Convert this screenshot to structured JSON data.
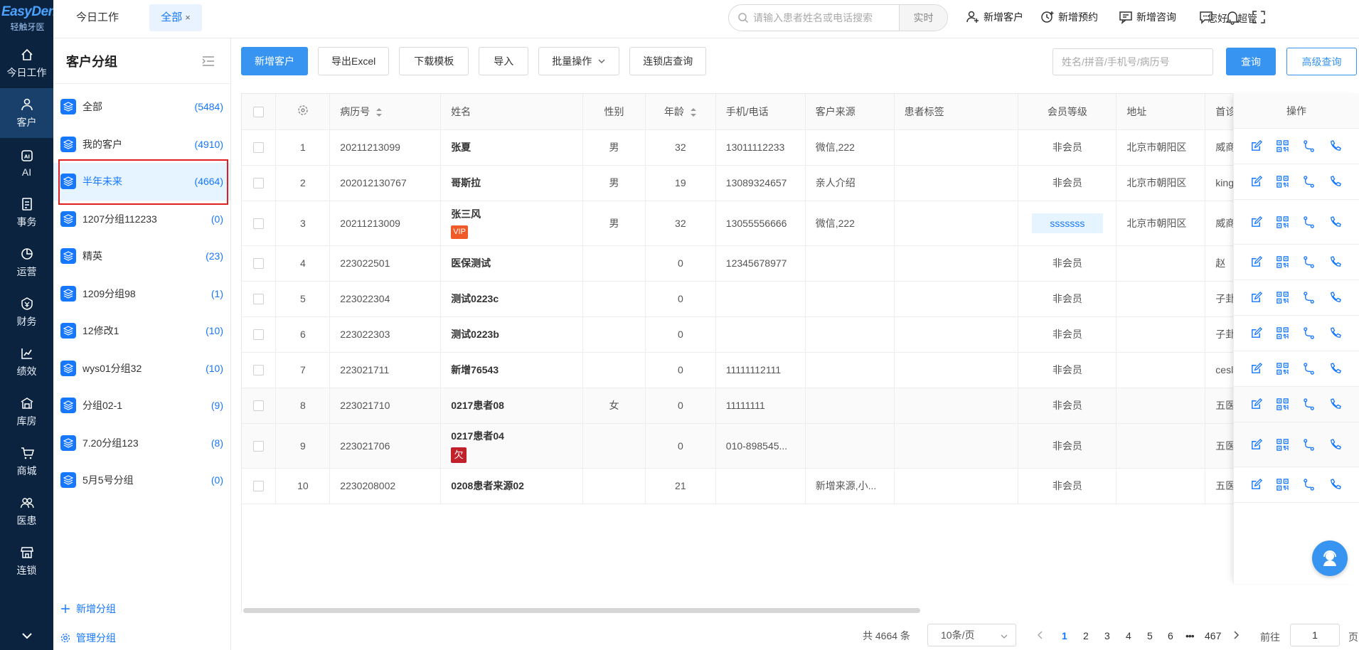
{
  "brand": {
    "name": "EasyDent",
    "sub": "轻触牙医"
  },
  "nav": [
    {
      "label": "今日工作",
      "icon": "home-icon"
    },
    {
      "label": "客户",
      "icon": "user-icon",
      "active": true
    },
    {
      "label": "AI",
      "icon": "ai-icon"
    },
    {
      "label": "事务",
      "icon": "task-icon"
    },
    {
      "label": "运营",
      "icon": "pie-chart-icon"
    },
    {
      "label": "财务",
      "icon": "finance-icon"
    },
    {
      "label": "绩效",
      "icon": "line-chart-icon"
    },
    {
      "label": "库房",
      "icon": "warehouse-icon"
    },
    {
      "label": "商城",
      "icon": "cart-icon"
    },
    {
      "label": "医患",
      "icon": "people-icon"
    },
    {
      "label": "连锁",
      "icon": "store-icon"
    }
  ],
  "tabs": {
    "today": "今日工作",
    "all": "全部",
    "close": "×"
  },
  "topsearch": {
    "placeholder": "请输入患者姓名或电话搜索",
    "mode": "实时"
  },
  "top_actions": {
    "add_customer": "新增客户",
    "add_appointment": "新增预约",
    "add_consult": "新增咨询",
    "greeting": "您好，超管"
  },
  "groups": {
    "title": "客户分组",
    "items": [
      {
        "name": "全部",
        "count": "(5484)"
      },
      {
        "name": "我的客户",
        "count": "(4910)"
      },
      {
        "name": "半年未来",
        "count": "(4664)",
        "selected": true
      },
      {
        "name": "1207分组112233",
        "count": "(0)"
      },
      {
        "name": "精英",
        "count": "(23)"
      },
      {
        "name": "1209分组98",
        "count": "(1)"
      },
      {
        "name": "12修改1",
        "count": "(10)"
      },
      {
        "name": "wys01分组32",
        "count": "(10)"
      },
      {
        "name": "分组02-1",
        "count": "(9)"
      },
      {
        "name": "7.20分组123",
        "count": "(8)"
      },
      {
        "name": "5月5号分组",
        "count": "(0)"
      }
    ],
    "add": "新增分组",
    "manage": "管理分组"
  },
  "toolbar": {
    "add_customer": "新增客户",
    "export_excel": "导出Excel",
    "download_template": "下载模板",
    "import": "导入",
    "batch": "批量操作",
    "chain_query": "连锁店查询",
    "search_placeholder": "姓名/拼音/手机号/病历号",
    "query": "查询",
    "advanced": "高级查询"
  },
  "table": {
    "headers": {
      "record": "病历号",
      "name": "姓名",
      "gender": "性别",
      "age": "年龄",
      "phone": "手机/电话",
      "source": "客户来源",
      "tag": "患者标签",
      "level": "会员等级",
      "address": "地址",
      "first": "首诊",
      "ops": "操作"
    },
    "rows": [
      {
        "idx": "1",
        "record": "20211213099",
        "name": "张夏",
        "gender": "男",
        "age": "32",
        "phone": "13011112233",
        "source": "微信,222",
        "level": "非会员",
        "address": "北京市朝阳区",
        "first": "威商"
      },
      {
        "idx": "2",
        "record": "202012130767",
        "name": "哥斯拉",
        "gender": "男",
        "age": "19",
        "phone": "13089324657",
        "source": "亲人介绍",
        "level": "非会员",
        "address": "北京市朝阳区",
        "first": "king"
      },
      {
        "idx": "3",
        "record": "20211213009",
        "name": "张三风",
        "badge": "VIP",
        "gender": "男",
        "age": "32",
        "phone": "13055556666",
        "source": "微信,222",
        "level": "sssssss",
        "level_tag": true,
        "address": "北京市朝阳区",
        "first": "威商"
      },
      {
        "idx": "4",
        "record": "223022501",
        "name": "医保测试",
        "gender": "",
        "age": "0",
        "phone": "12345678977",
        "source": "",
        "level": "非会员",
        "address": "",
        "first": "赵"
      },
      {
        "idx": "5",
        "record": "223022304",
        "name": "测试0223c",
        "gender": "",
        "age": "0",
        "phone": "",
        "source": "",
        "level": "非会员",
        "address": "",
        "first": "子卦"
      },
      {
        "idx": "6",
        "record": "223022303",
        "name": "测试0223b",
        "gender": "",
        "age": "0",
        "phone": "",
        "source": "",
        "level": "非会员",
        "address": "",
        "first": "子卦"
      },
      {
        "idx": "7",
        "record": "223021711",
        "name": "新增76543",
        "gender": "",
        "age": "0",
        "phone": "11111112111",
        "source": "",
        "level": "非会员",
        "address": "",
        "first": "cesl"
      },
      {
        "idx": "8",
        "record": "223021710",
        "name": "0217患者08",
        "gender": "女",
        "age": "0",
        "phone": "11111111",
        "source": "",
        "level": "非会员",
        "address": "",
        "first": "五医"
      },
      {
        "idx": "9",
        "record": "223021706",
        "name": "0217患者04",
        "badge": "欠",
        "gender": "",
        "age": "0",
        "phone": "010-898545...",
        "source": "",
        "level": "非会员",
        "address": "",
        "first": "五医"
      },
      {
        "idx": "10",
        "record": "2230208002",
        "name": "0208患者来源02",
        "gender": "",
        "age": "21",
        "phone": "",
        "source": "新增来源,小...",
        "level": "非会员",
        "address": "",
        "first": "五医"
      }
    ]
  },
  "pagination": {
    "total": "共 4664 条",
    "page_size": "10条/页",
    "pages": [
      "1",
      "2",
      "3",
      "4",
      "5",
      "6"
    ],
    "ellipsis": "•••",
    "last": "467",
    "current": "1",
    "goto": "前往",
    "goto_value": "1",
    "page_unit": "页"
  },
  "colors": {
    "nav_bg": "#0c2340",
    "primary": "#3794f0",
    "link": "#1677ff",
    "vip": "#f05a28",
    "owe": "#c0212b",
    "highlight_border": "#e02020"
  }
}
